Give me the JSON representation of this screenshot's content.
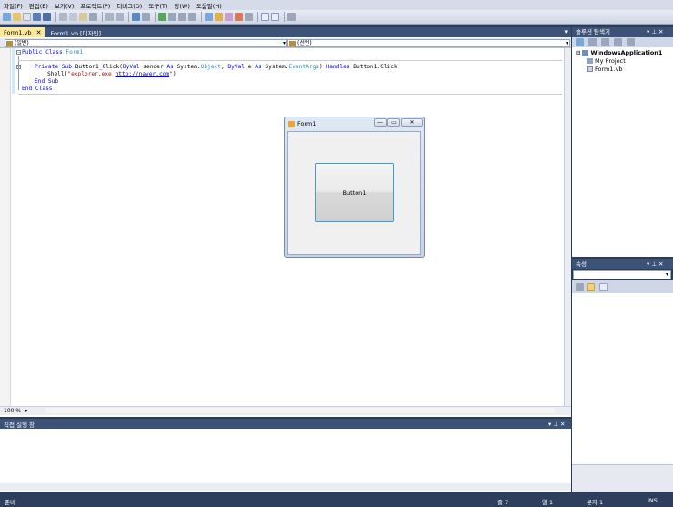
{
  "menu": [
    "파일(F)",
    "편집(E)",
    "보기(V)",
    "프로젝트(P)",
    "디버그(D)",
    "도구(T)",
    "창(W)",
    "도움말(H)"
  ],
  "tabs": [
    {
      "label": "Form1.vb",
      "close": "✕"
    },
    {
      "label": "Form1.vb [디자인]"
    }
  ],
  "tab_dropdown": "▾",
  "nav": {
    "left": "(일반)",
    "right": "(선언)"
  },
  "code": {
    "l1_kw": "Public Class",
    "l1_name": " Form1",
    "l2_kw": "Private Sub",
    "l2_a": " Button1_Click(",
    "l2_kw2": "ByVal",
    "l2_b": " sender ",
    "l2_kw3": "As",
    "l2_c": " System.",
    "l2_ty": "Object",
    "l2_d": ", ",
    "l2_kw4": "ByVal",
    "l2_e": " e ",
    "l2_kw5": "As",
    "l2_f": " System.",
    "l2_ty2": "EventArgs",
    "l2_g": ") ",
    "l2_kw6": "Handles",
    "l2_h": " Button1.Click",
    "l3_a": "Shell(",
    "l3_str": "\"explorer.exe ",
    "l3_link": "http://naver.com",
    "l3_str2": "\"",
    "l3_b": ")",
    "l4_kw": "End Sub",
    "l5_kw": "End Class"
  },
  "zoom": "100 %",
  "form": {
    "title": "Form1",
    "button": "Button1",
    "min": "—",
    "max": "▭",
    "close": "✕"
  },
  "immediate": {
    "title": "직접 실행 창",
    "controls": "▾ ⊥ ✕"
  },
  "solution": {
    "title": "솔루션 탐색기",
    "controls": "▾ ⊥ ✕",
    "root": "WindowsApplication1",
    "items": [
      "My Project",
      "Form1.vb"
    ]
  },
  "properties": {
    "title": "속성",
    "controls": "▾ ⊥ ✕"
  },
  "status": {
    "ready": "준비",
    "line": "줄 7",
    "col": "열 1",
    "char": "문자 1",
    "mode": "INS"
  },
  "colors": {
    "chrome": "#3d5277",
    "active_tab": "#fde99d",
    "accent": "#3c9bdb"
  }
}
